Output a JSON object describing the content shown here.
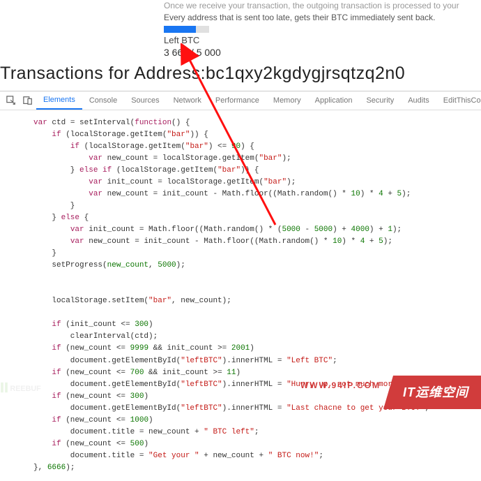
{
  "top": {
    "line1_faded": "Once we receive your transaction, the outgoing transaction is processed to your",
    "line2": "Every address that is sent too late, gets their BTC immediately sent back.",
    "left_btc_label": "Left BTC",
    "count": "3 660 / 5 000"
  },
  "heading": "Transactions for Address:bc1qxy2kgdygjrsqtzq2n0",
  "devtools": {
    "tabs": [
      "Elements",
      "Console",
      "Sources",
      "Network",
      "Performance",
      "Memory",
      "Application",
      "Security",
      "Audits",
      "EditThisCookie"
    ],
    "active_tab_index": 0,
    "more": "⋮"
  },
  "code": {
    "l0": "var ctd = setInterval(function() {",
    "l1": "    if (localStorage.getItem(\"bar\")) {",
    "l2": "        if (localStorage.getItem(\"bar\") <= 90) {",
    "l3": "            var new_count = localStorage.getItem(\"bar\");",
    "l4": "        } else if (localStorage.getItem(\"bar\")) {",
    "l5": "            var init_count = localStorage.getItem(\"bar\");",
    "l6": "            var new_count = init_count - Math.floor((Math.random() * 10) * 4 + 5);",
    "l7": "        }",
    "l8": "    } else {",
    "l9": "        var init_count = Math.floor((Math.random() * (5000 - 5000) + 4000) + 1);",
    "l10": "        var new_count = init_count - Math.floor((Math.random() * 10) * 4 + 5);",
    "l11": "    }",
    "l12": "    setProgress(new_count, 5000);",
    "l13": "",
    "l14": "",
    "l15": "    localStorage.setItem(\"bar\", new_count);",
    "l16": "",
    "l17": "    if (init_count <= 300)",
    "l18": "        clearInterval(ctd);",
    "l19": "    if (new_count <= 9999 && init_count >= 2001)",
    "l20": "        document.getElementById(\"leftBTC\").innerHTML = \"Left BTC\";",
    "l21": "    if (new_count <= 700 && init_count >= 11)",
    "l22": "        document.getElementById(\"leftBTC\").innerHTML = \"Hurry up, not much more BTC left!\";",
    "l23": "    if (new_count <= 300)",
    "l24": "        document.getElementById(\"leftBTC\").innerHTML = \"Last chacne to get your BTC!\";",
    "l25": "    if (new_count <= 1000)",
    "l26": "        document.title = new_count + \" BTC left\";",
    "l27": "    if (new_count <= 500)",
    "l28": "        document.title = \"Get your \" + new_count + \" BTC now!\";",
    "l29": "}, 6666);"
  },
  "watermark": {
    "url": "WWW.94IP.COM",
    "banner": "IT运维空间",
    "left_logo": "FREEBUF"
  }
}
